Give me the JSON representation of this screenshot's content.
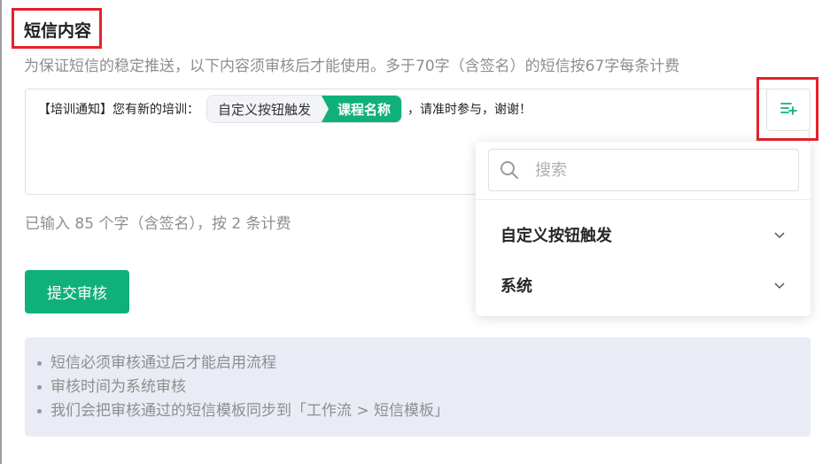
{
  "section": {
    "title": "短信内容",
    "hint": "为保证短信的稳定推送，以下内容须审核后才能使用。多于70字（含签名）的短信按67字每条计费"
  },
  "editor": {
    "prefix": "【培训通知】您有新的培训：",
    "tag_trigger": "自定义按钮触发",
    "tag_field": "课程名称",
    "suffix": "，请准时参与，谢谢！"
  },
  "count_text": "已输入 85 个字（含签名），按 2 条计费",
  "submit_label": "提交审核",
  "notes": [
    "短信必须审核通过后才能启用流程",
    "审核时间为系统审核",
    "我们会把审核通过的短信模板同步到「工作流 > 短信模板」"
  ],
  "dropdown": {
    "search_placeholder": "搜索",
    "groups": [
      {
        "label": "自定义按钮触发"
      },
      {
        "label": "系统"
      }
    ]
  },
  "colors": {
    "accent": "#10b07b",
    "highlight": "#e5212b",
    "notes_bg": "#e9ecf5"
  },
  "icons": [
    "insert-variable-icon",
    "search-icon",
    "chevron-down-icon"
  ]
}
